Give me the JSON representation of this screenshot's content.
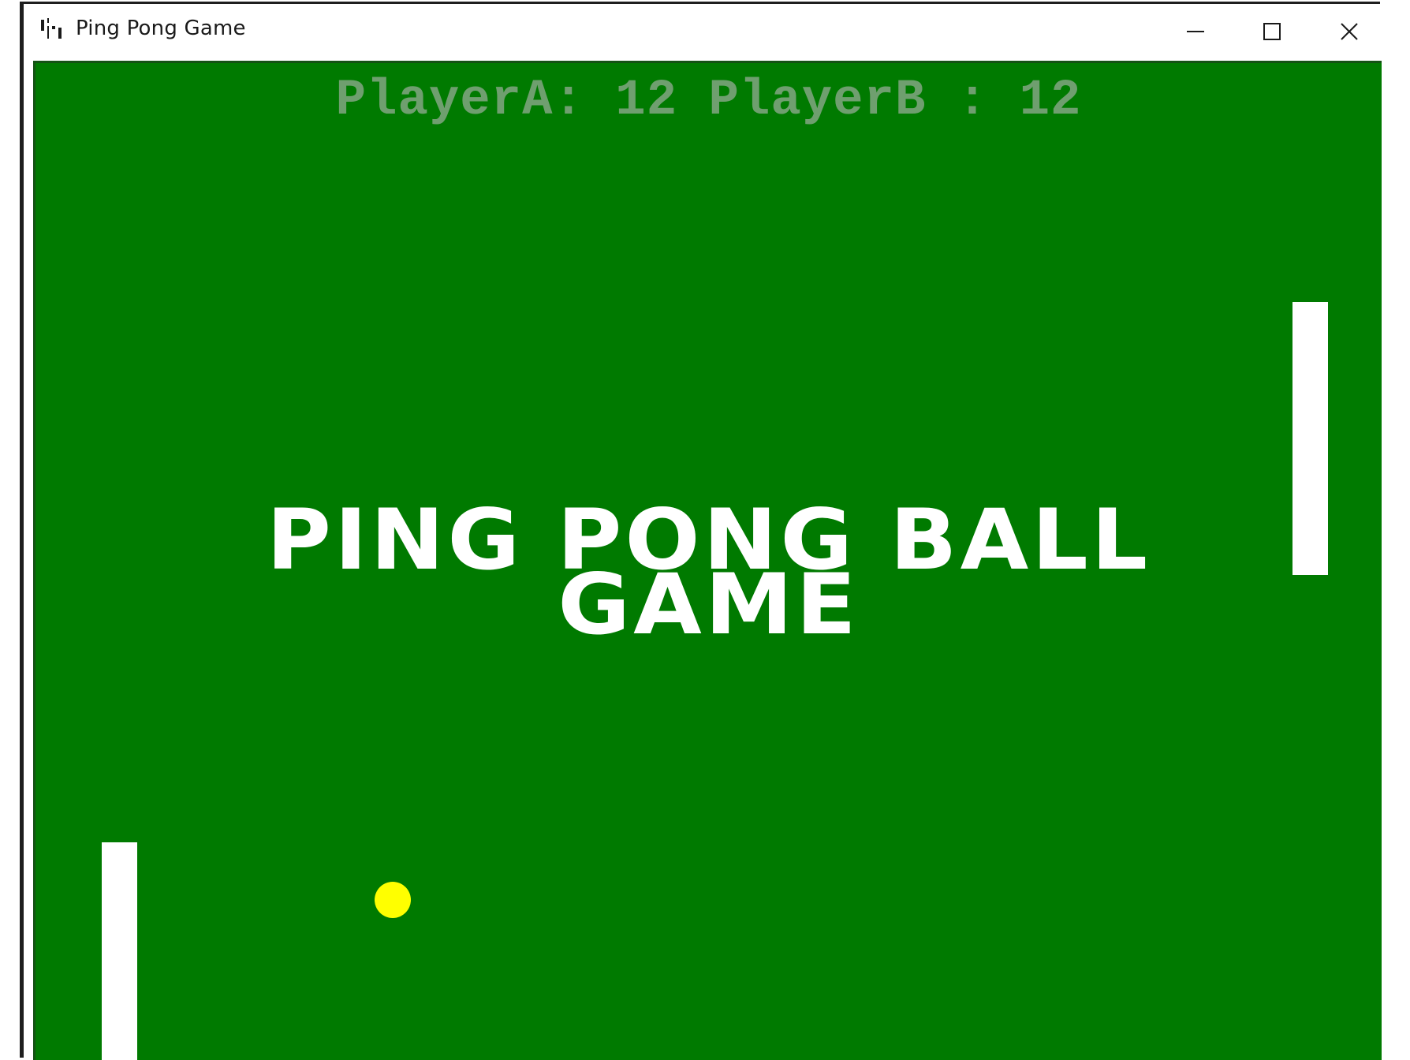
{
  "window": {
    "title": "Ping Pong Game",
    "app_icon": "pingpong-app-icon",
    "controls": {
      "minimize_icon": "minimize-icon",
      "maximize_icon": "maximize-icon",
      "close_icon": "close-icon"
    }
  },
  "game": {
    "scoreboard": {
      "text": "PlayerA: 12 PlayerB : 12",
      "player_a_score": 12,
      "player_b_score": 12
    },
    "title_line1": "PING PONG BALL",
    "title_line2": "GAME",
    "colors": {
      "background": "#007a00",
      "paddle": "#ffffff",
      "ball": "#ffff00",
      "score_text": "#6f9f6f",
      "title_text": "#ffffff"
    }
  }
}
